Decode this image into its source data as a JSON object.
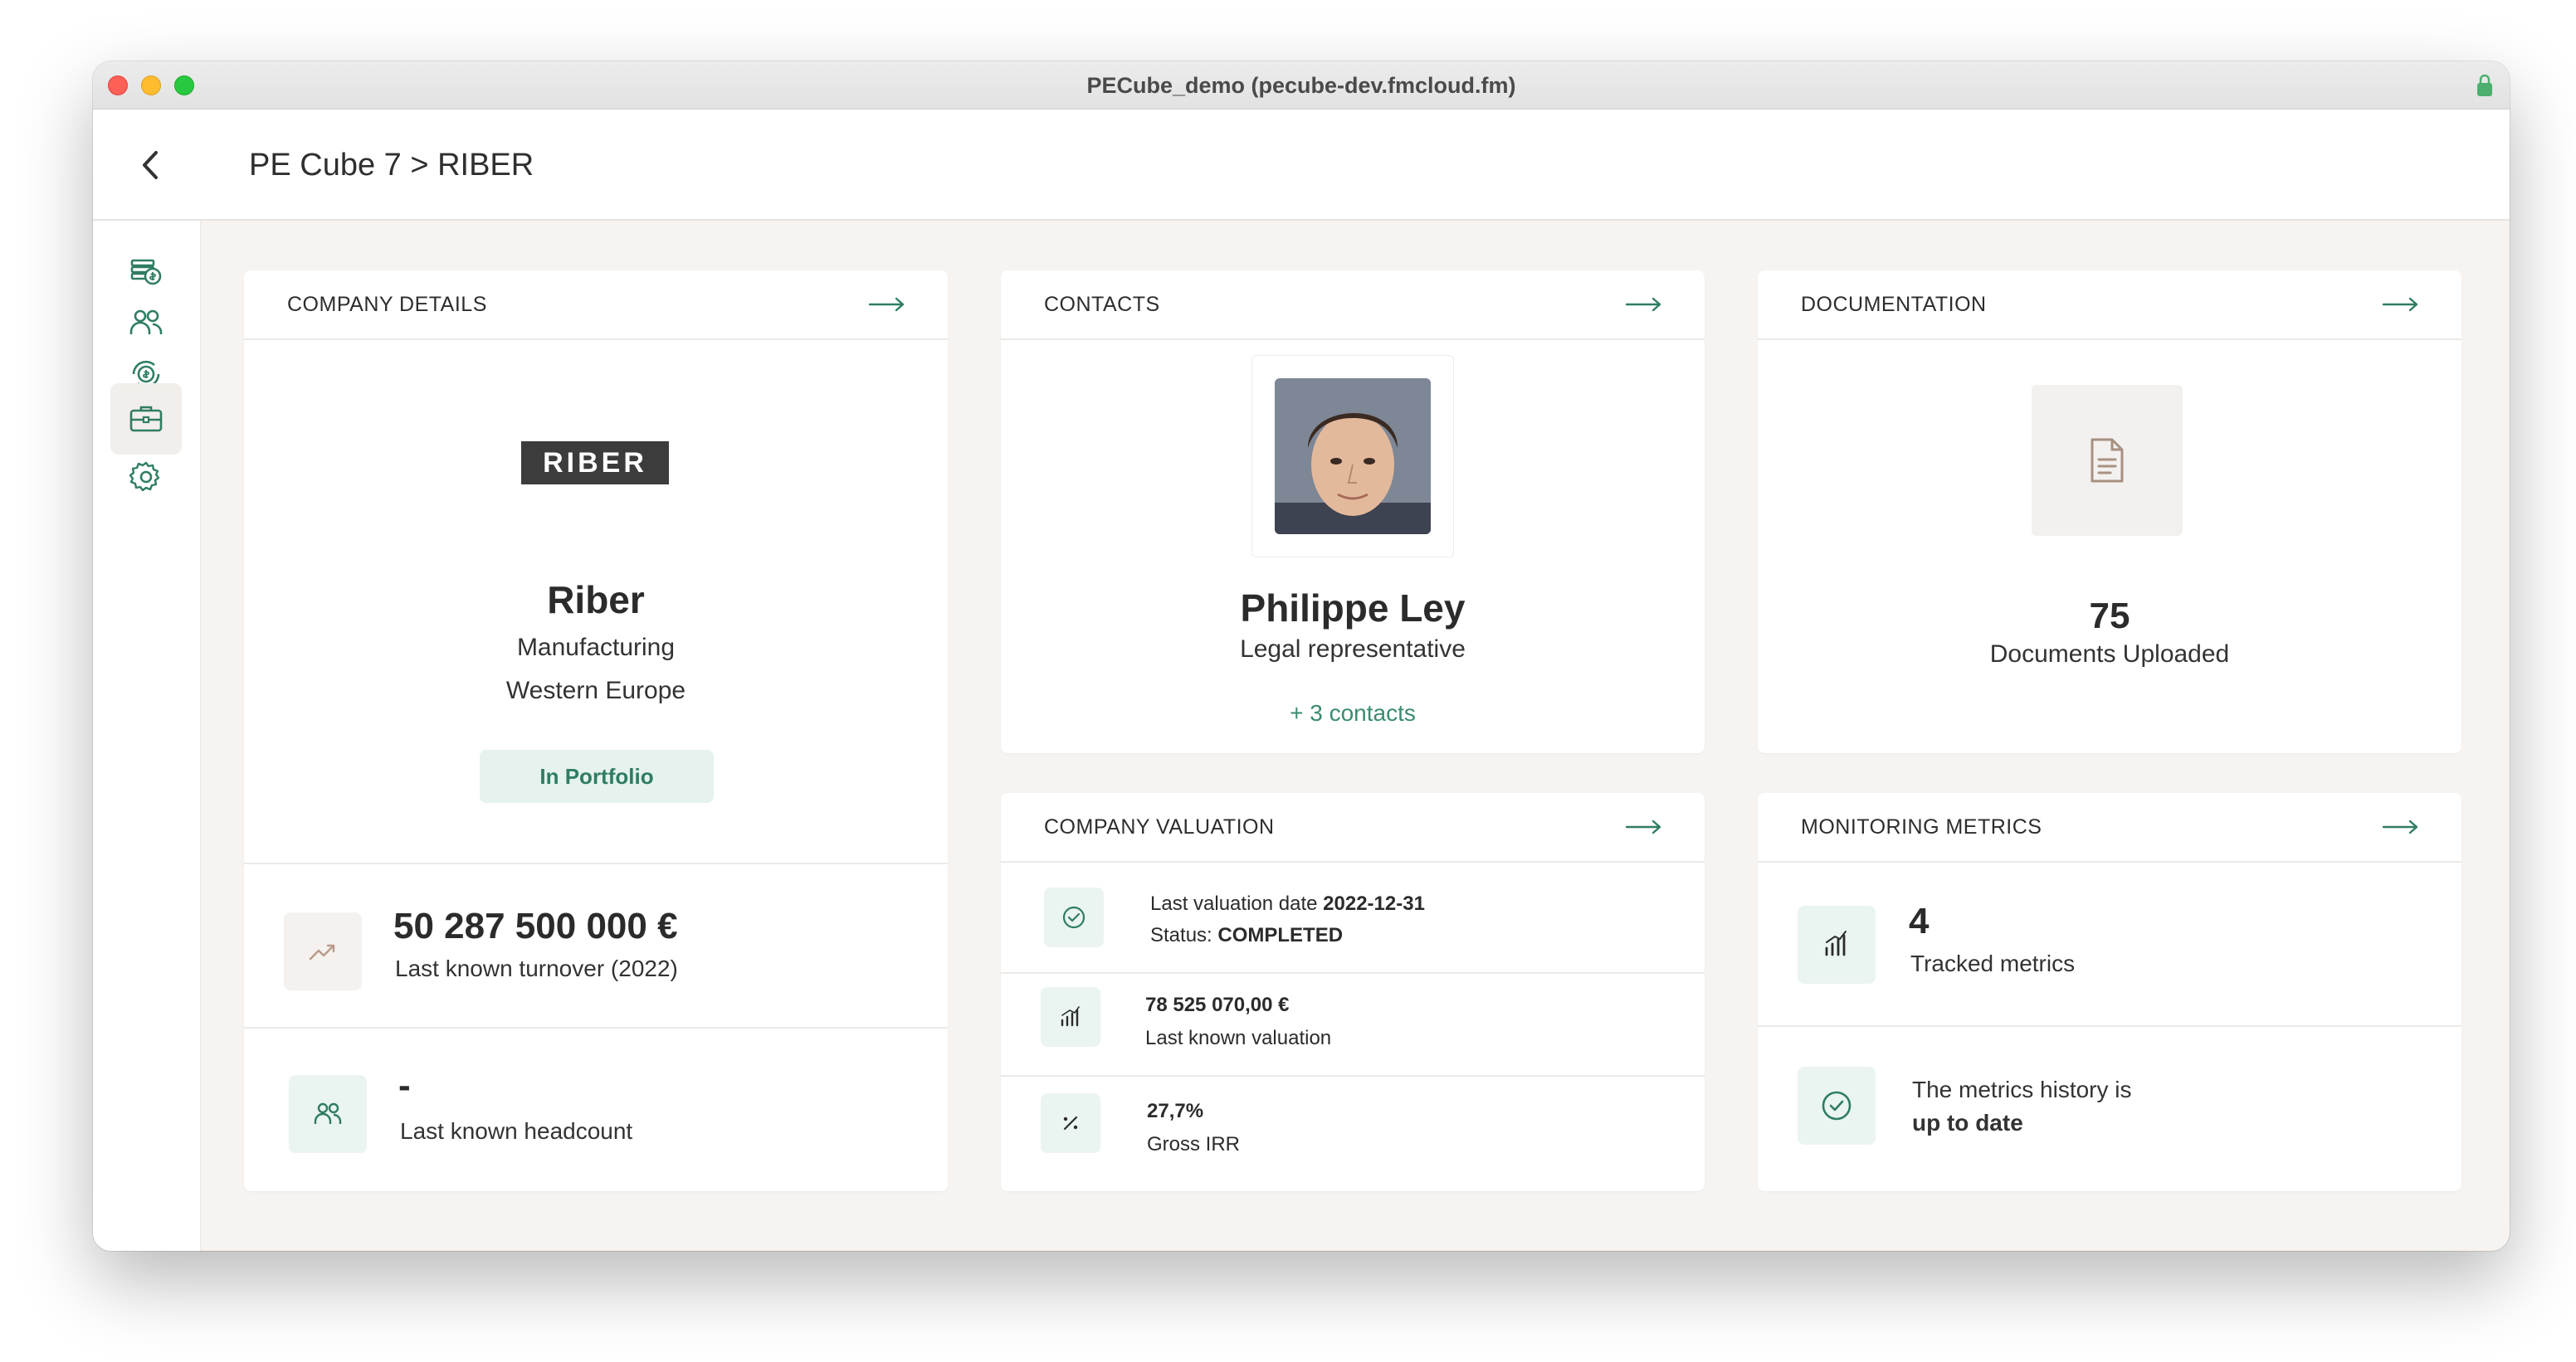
{
  "window": {
    "title": "PECube_demo (pecube-dev.fmcloud.fm)"
  },
  "header": {
    "breadcrumb": "PE Cube 7 > RIBER"
  },
  "sidebar": {
    "items": [
      {
        "icon": "money-stack-icon",
        "active": false
      },
      {
        "icon": "people-icon",
        "active": false
      },
      {
        "icon": "cash-cycle-icon",
        "active": false
      },
      {
        "icon": "briefcase-icon",
        "active": true
      },
      {
        "icon": "gear-icon",
        "active": false
      }
    ]
  },
  "company": {
    "title": "COMPANY DETAILS",
    "logo_text": "RIBER",
    "name": "Riber",
    "sector": "Manufacturing",
    "region": "Western Europe",
    "status": "In Portfolio",
    "turnover_value": "50 287 500 000 €",
    "turnover_label": "Last known turnover (2022)",
    "headcount_value": "-",
    "headcount_label": "Last known headcount"
  },
  "contacts": {
    "title": "CONTACTS",
    "name": "Philippe Ley",
    "role": "Legal representative",
    "more": "+ 3 contacts"
  },
  "documentation": {
    "title": "DOCUMENTATION",
    "count": "75",
    "label": "Documents Uploaded"
  },
  "valuation": {
    "title": "COMPANY VALUATION",
    "date_prefix": "Last valuation date",
    "date": "2022-12-31",
    "status_prefix": "Status:",
    "status": "COMPLETED",
    "value": "78 525 070,00 €",
    "value_label": "Last known valuation",
    "irr": "27,7%",
    "irr_label": "Gross IRR"
  },
  "metrics": {
    "title": "MONITORING METRICS",
    "count": "4",
    "count_label": "Tracked metrics",
    "history_text": "The metrics history is",
    "history_status": "up to date"
  },
  "colors": {
    "accent_green": "#3a8c6e",
    "pill_bg": "#e5f2ed",
    "logo_bg": "#3c3c3c",
    "page_bg": "#f6f3f0"
  }
}
